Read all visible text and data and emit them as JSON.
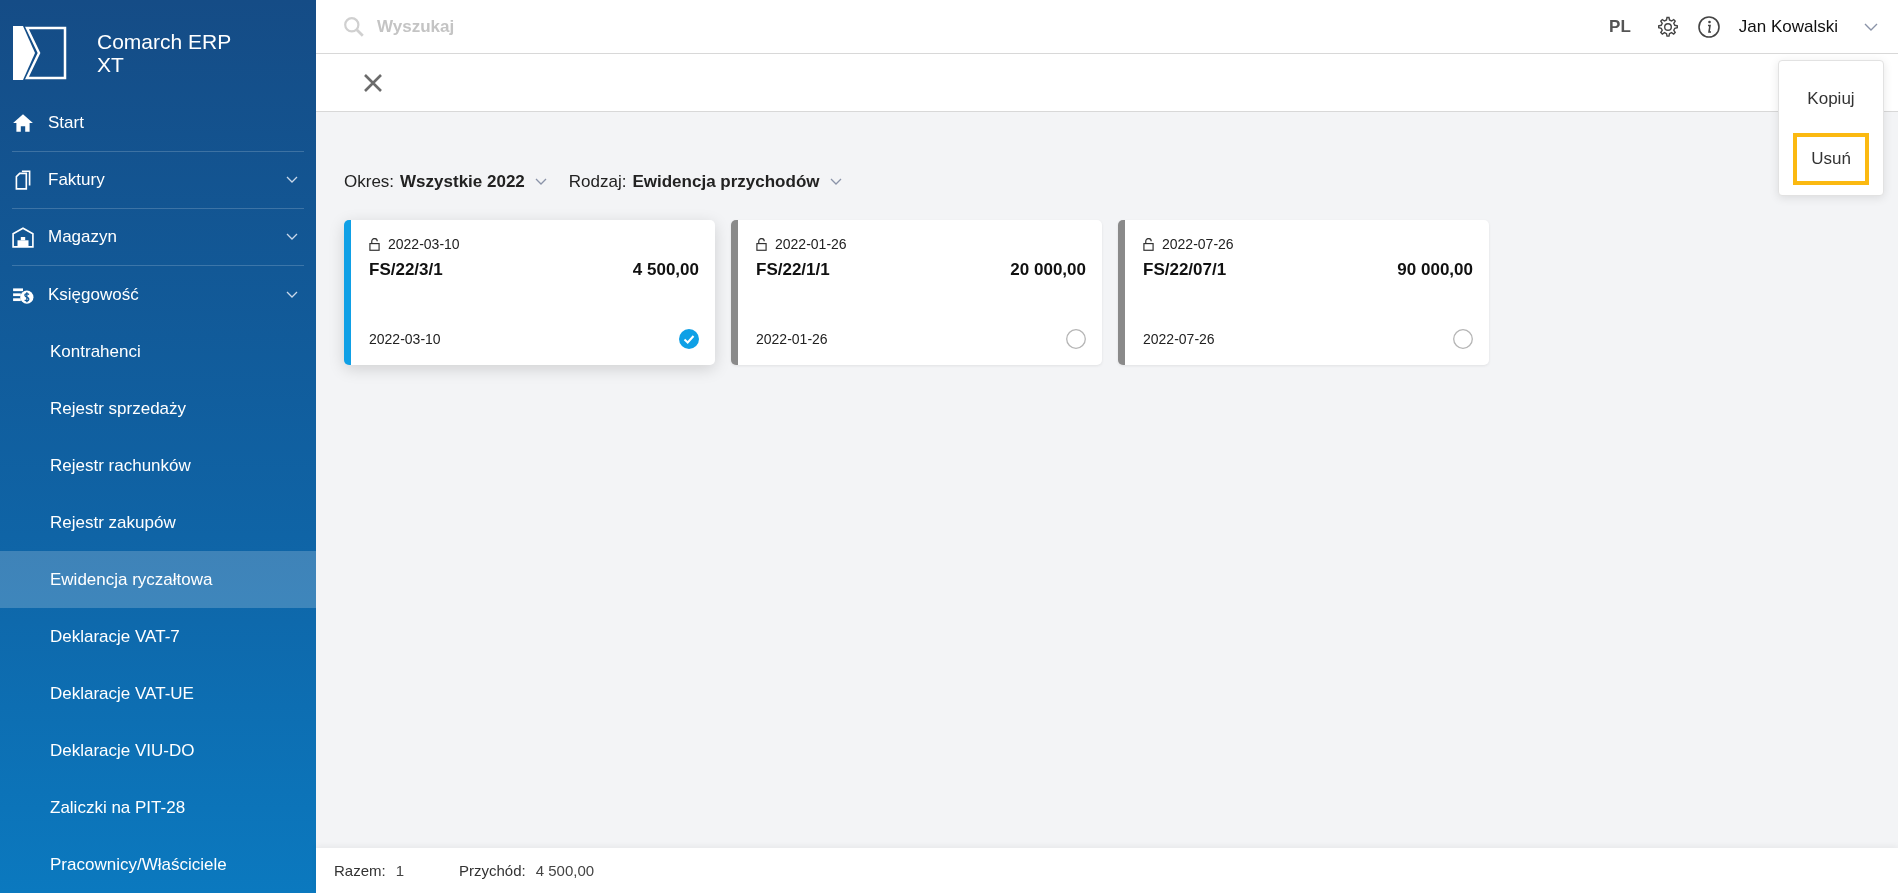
{
  "app": {
    "name": "Comarch ERP XT"
  },
  "sidebar": {
    "items": [
      {
        "label": "Start",
        "expandable": false
      },
      {
        "label": "Faktury",
        "expandable": true
      },
      {
        "label": "Magazyn",
        "expandable": true
      },
      {
        "label": "Księgowość",
        "expandable": true,
        "children": [
          {
            "label": "Kontrahenci",
            "selected": false
          },
          {
            "label": "Rejestr sprzedaży",
            "selected": false
          },
          {
            "label": "Rejestr rachunków",
            "selected": false
          },
          {
            "label": "Rejestr zakupów",
            "selected": false
          },
          {
            "label": "Ewidencja ryczałtowa",
            "selected": true
          },
          {
            "label": "Deklaracje VAT-7",
            "selected": false
          },
          {
            "label": "Deklaracje VAT-UE",
            "selected": false
          },
          {
            "label": "Deklaracje VIU-DO",
            "selected": false
          },
          {
            "label": "Zaliczki na PIT-28",
            "selected": false
          },
          {
            "label": "Pracownicy/Właściciele",
            "selected": false
          }
        ]
      }
    ]
  },
  "topbar": {
    "search": {
      "placeholder": "Wyszukaj"
    },
    "language": "PL",
    "user": "Jan Kowalski"
  },
  "context_menu": {
    "items": [
      {
        "label": "Kopiuj",
        "highlighted": false
      },
      {
        "label": "Usuń",
        "highlighted": true
      }
    ]
  },
  "filters": [
    {
      "label": "Okres:",
      "value": "Wszystkie 2022"
    },
    {
      "label": "Rodzaj:",
      "value": "Ewidencja przychodów"
    }
  ],
  "cards": [
    {
      "locked_date": "2022-03-10",
      "number": "FS/22/3/1",
      "amount": "4 500,00",
      "date": "2022-03-10",
      "selected": true
    },
    {
      "locked_date": "2022-01-26",
      "number": "FS/22/1/1",
      "amount": "20 000,00",
      "date": "2022-01-26",
      "selected": false
    },
    {
      "locked_date": "2022-07-26",
      "number": "FS/22/07/1",
      "amount": "90 000,00",
      "date": "2022-07-26",
      "selected": false
    }
  ],
  "status_bar": [
    {
      "label": "Razem:",
      "value": "1"
    },
    {
      "label": "Przychód:",
      "value": "4 500,00"
    }
  ]
}
